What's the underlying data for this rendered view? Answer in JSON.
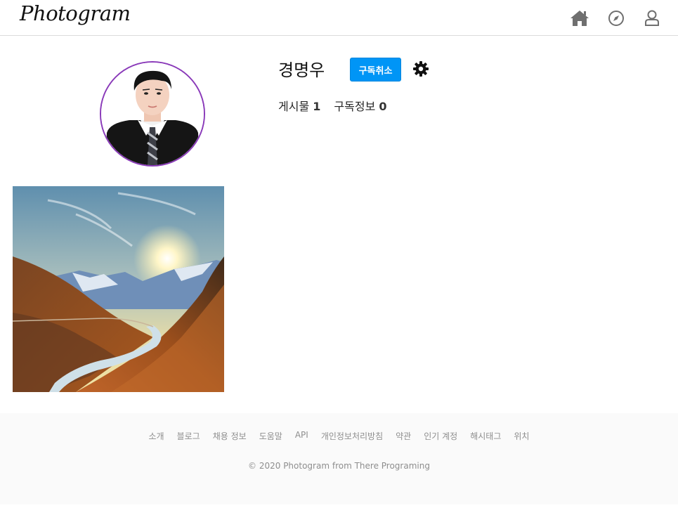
{
  "header": {
    "logo": "Photogram",
    "icons": [
      "home-icon",
      "compass-icon",
      "user-icon"
    ]
  },
  "profile": {
    "name": "경명우",
    "unsubscribe_label": "구독취소",
    "posts_label": "게시물",
    "posts_count": "1",
    "subscribe_label": "구독정보",
    "subscribe_count": "0"
  },
  "footer": {
    "links": [
      "소개",
      "블로그",
      "채용 정보",
      "도움말",
      "API",
      "개인정보처리방침",
      "약관",
      "인기 계정",
      "해시태그",
      "위치"
    ],
    "copyright": "© 2020 Photogram from There Programing"
  },
  "colors": {
    "accent": "#0095f6",
    "avatar_ring": "#8a3ab9",
    "footer_bg": "#fafafa"
  }
}
